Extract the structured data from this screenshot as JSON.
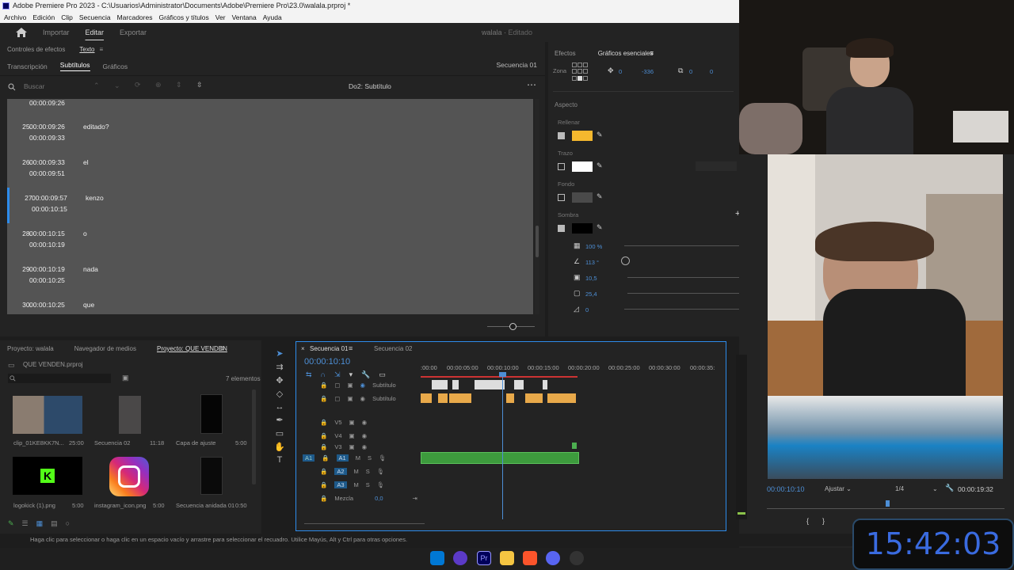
{
  "window": {
    "title": "Adobe Premiere Pro 2023 - C:\\Usuarios\\Administrator\\Documents\\Adobe\\Premiere Pro\\23.0\\walala.prproj *"
  },
  "menu": [
    "Archivo",
    "Edición",
    "Clip",
    "Secuencia",
    "Marcadores",
    "Gráficos y títulos",
    "Ver",
    "Ventana",
    "Ayuda"
  ],
  "workspace": {
    "tabs": [
      "Importar",
      "Editar",
      "Exportar"
    ],
    "active": "Editar",
    "project": "walala",
    "status": "Editado"
  },
  "top_panel": {
    "tabs": [
      "Controles de efectos",
      "Texto"
    ],
    "active": "Texto",
    "subtabs": [
      "Transcripción",
      "Subtítulos",
      "Gráficos"
    ],
    "active_subtab": "Subtítulos",
    "sequence": "Secuencia 01",
    "search_placeholder": "Buscar",
    "track_name": "Do2: Subtítulo"
  },
  "captions": [
    {
      "num": "",
      "start": "00:00:09:26",
      "end": "",
      "text": ""
    },
    {
      "num": "25.",
      "start": "00:00:09:26",
      "end": "00:00:09:33",
      "text": "editado?"
    },
    {
      "num": "26.",
      "start": "00:00:09:33",
      "end": "00:00:09:51",
      "text": "el"
    },
    {
      "num": "27.",
      "start": "00:00:09:57",
      "end": "00:00:10:15",
      "text": "kenzo"
    },
    {
      "num": "28.",
      "start": "00:00:10:15",
      "end": "00:00:10:19",
      "text": "o"
    },
    {
      "num": "29.",
      "start": "00:00:10:19",
      "end": "00:00:10:25",
      "text": "nada"
    },
    {
      "num": "30.",
      "start": "00:00:10:25",
      "end": "",
      "text": "que"
    }
  ],
  "essential": {
    "tabs": [
      "Efectos",
      "Gráficos esenciales"
    ],
    "active": "Gráficos esenciales",
    "zona_label": "Zona",
    "pos_x": "0",
    "pos_y": "-336",
    "anchor_x": "0",
    "anchor_y": "0",
    "aspecto": "Aspecto",
    "rellenar": "Rellenar",
    "trazo": "Trazo",
    "fondo": "Fondo",
    "sombra": "Sombra",
    "opacity": "100 %",
    "angle": "113 °",
    "distance": "10,5",
    "size": "25,4",
    "blur": "0",
    "fill_color": "#f5b82e",
    "stroke_color": "#ffffff",
    "shadow_color": "#000000"
  },
  "project_panel": {
    "tabs": [
      "Proyecto: walala",
      "Navegador de medios",
      "Proyecto: QUE VENDEN"
    ],
    "active": "Proyecto: QUE VENDEN",
    "file": "QUE VENDEN.prproj",
    "count": "7 elementos",
    "items": [
      {
        "name": "clip_01KE8KK7N...",
        "dur": "25:00"
      },
      {
        "name": "Secuencia 02",
        "dur": "11:18"
      },
      {
        "name": "Capa de ajuste",
        "dur": "5:00"
      },
      {
        "name": "logokick (1).png",
        "dur": "5:00"
      },
      {
        "name": "instagram_icon.png",
        "dur": "5:00"
      },
      {
        "name": "Secuencia anidada 01",
        "dur": "0:50"
      }
    ]
  },
  "timeline": {
    "tabs": [
      "Secuencia 01",
      "Secuencia 02"
    ],
    "active": "Secuencia 01",
    "timecode": "00:00:10:10",
    "ruler": [
      ":00:00",
      "00:00:05:00",
      "00:00:10:00",
      "00:00:15:00",
      "00:00:20:00",
      "00:00:25:00",
      "00:00:30:00",
      "00:00:35:"
    ],
    "caption_tracks": [
      "Subtítulo",
      "Subtítulo"
    ],
    "video_tracks": [
      "V5",
      "V4",
      "V3"
    ],
    "audio_tracks": [
      "A1",
      "A2",
      "A3"
    ],
    "mix_label": "Mezcla",
    "mix_value": "0,0"
  },
  "program": {
    "timecode": "00:00:10:10",
    "fit": "Ajustar",
    "res": "1/4",
    "duration": "00:00:19:32"
  },
  "status_bar": "Haga clic para seleccionar o haga clic en un espacio vacío y arrastre para seleccionar el recuadro. Utilice Mayús, Alt y Ctrl para otras opciones.",
  "clock": "15:42:03"
}
